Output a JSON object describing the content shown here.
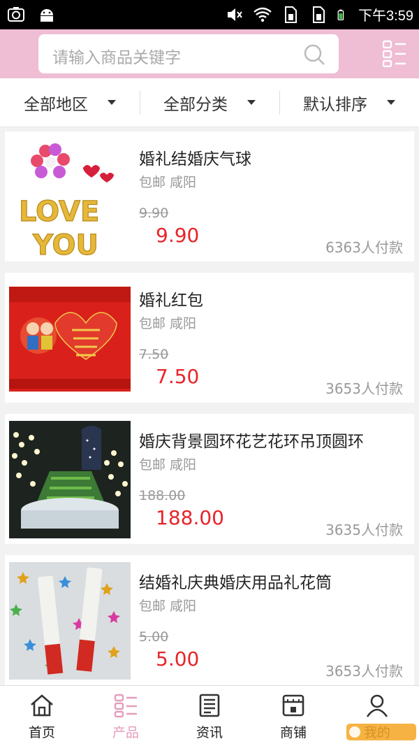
{
  "status_bar": {
    "time": "下午3:59"
  },
  "search": {
    "placeholder": "请输入商品关键字"
  },
  "filters": [
    {
      "label": "全部地区"
    },
    {
      "label": "全部分类"
    },
    {
      "label": "默认排序"
    }
  ],
  "products": [
    {
      "title": "婚礼结婚庆气球",
      "shipping": "包邮 咸阳",
      "original_price": "9.90",
      "price": "9.90",
      "sales": "6363人付款"
    },
    {
      "title": "婚礼红包",
      "shipping": "包邮 咸阳",
      "original_price": "7.50",
      "price": "7.50",
      "sales": "3653人付款"
    },
    {
      "title": "婚庆背景圆环花艺花环吊顶圆环",
      "shipping": "包邮 咸阳",
      "original_price": "188.00",
      "price": "188.00",
      "sales": "3635人付款"
    },
    {
      "title": "结婚礼庆典婚庆用品礼花筒",
      "shipping": "包邮 咸阳",
      "original_price": "5.00",
      "price": "5.00",
      "sales": "3653人付款"
    }
  ],
  "tabs": [
    {
      "label": "首页",
      "icon": "home-icon"
    },
    {
      "label": "产品",
      "icon": "grid-list-icon",
      "active": true
    },
    {
      "label": "资讯",
      "icon": "news-icon"
    },
    {
      "label": "商铺",
      "icon": "shop-icon"
    },
    {
      "label": "我的",
      "icon": "user-icon"
    }
  ],
  "colors": {
    "header": "#efbdd4",
    "accent": "#e59cbd",
    "price": "#e8242a"
  }
}
